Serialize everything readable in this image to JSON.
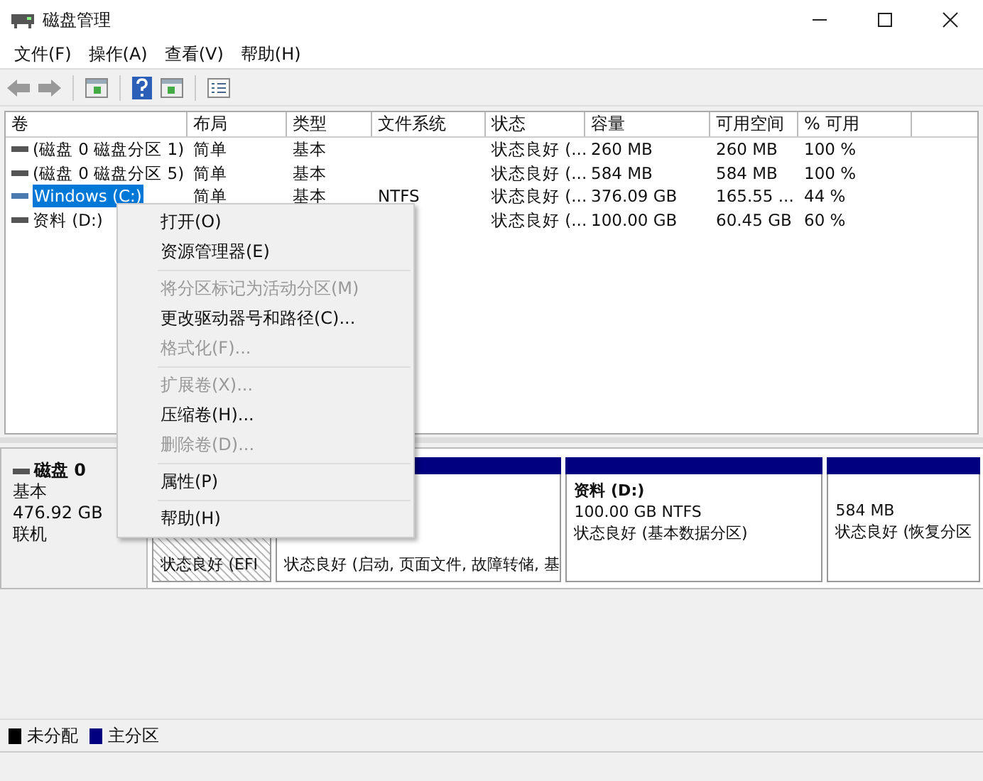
{
  "window": {
    "title": "磁盘管理"
  },
  "menu_bar": [
    "文件(F)",
    "操作(A)",
    "查看(V)",
    "帮助(H)"
  ],
  "volume_table": {
    "columns": [
      "卷",
      "布局",
      "类型",
      "文件系统",
      "状态",
      "容量",
      "可用空间",
      "% 可用"
    ],
    "rows": [
      {
        "selected": false,
        "cells": [
          "(磁盘 0 磁盘分区 1)",
          "简单",
          "基本",
          "",
          "状态良好 (...",
          "260 MB",
          "260 MB",
          "100 %"
        ]
      },
      {
        "selected": false,
        "cells": [
          "(磁盘 0 磁盘分区 5)",
          "简单",
          "基本",
          "",
          "状态良好 (...",
          "584 MB",
          "584 MB",
          "100 %"
        ]
      },
      {
        "selected": true,
        "cells": [
          "Windows (C:)",
          "简单",
          "基本",
          "NTFS",
          "状态良好 (...",
          "376.09 GB",
          "165.55 ...",
          "44 %"
        ]
      },
      {
        "selected": false,
        "cells": [
          "资料 (D:)",
          "",
          "",
          "",
          "状态良好 (...",
          "100.00 GB",
          "60.45 GB",
          "60 %"
        ]
      }
    ]
  },
  "disk": {
    "name": "磁盘 0",
    "type": "基本",
    "size": "476.92 GB",
    "status": "联机",
    "partitions": [
      {
        "selected": true,
        "lines": [
          "状态良好 (EFI"
        ]
      },
      {
        "selected": false,
        "color": "#000080",
        "lines": [
          "状态良好 (启动, 页面文件, 故障转储, 基"
        ]
      },
      {
        "selected": false,
        "color": "#000080",
        "title": "资料  (D:)",
        "lines": [
          "100.00 GB NTFS",
          "状态良好 (基本数据分区)"
        ]
      },
      {
        "selected": false,
        "color": "#000080",
        "lines": [
          "584 MB",
          "状态良好 (恢复分区"
        ]
      }
    ]
  },
  "legend": [
    {
      "label": "未分配",
      "color": "#000000"
    },
    {
      "label": "主分区",
      "color": "#000080"
    }
  ],
  "context_menu": [
    {
      "kind": "item",
      "label": "打开(O)",
      "disabled": false
    },
    {
      "kind": "item",
      "label": "资源管理器(E)",
      "disabled": false
    },
    {
      "kind": "separator"
    },
    {
      "kind": "item",
      "label": "将分区标记为活动分区(M)",
      "disabled": true
    },
    {
      "kind": "item",
      "label": "更改驱动器号和路径(C)...",
      "disabled": false
    },
    {
      "kind": "item",
      "label": "格式化(F)...",
      "disabled": true
    },
    {
      "kind": "separator"
    },
    {
      "kind": "item",
      "label": "扩展卷(X)...",
      "disabled": true
    },
    {
      "kind": "item",
      "label": "压缩卷(H)...",
      "disabled": false
    },
    {
      "kind": "item",
      "label": "删除卷(D)...",
      "disabled": true
    },
    {
      "kind": "separator"
    },
    {
      "kind": "item",
      "label": "属性(P)",
      "disabled": false
    },
    {
      "kind": "separator"
    },
    {
      "kind": "item",
      "label": "帮助(H)",
      "disabled": false
    }
  ]
}
